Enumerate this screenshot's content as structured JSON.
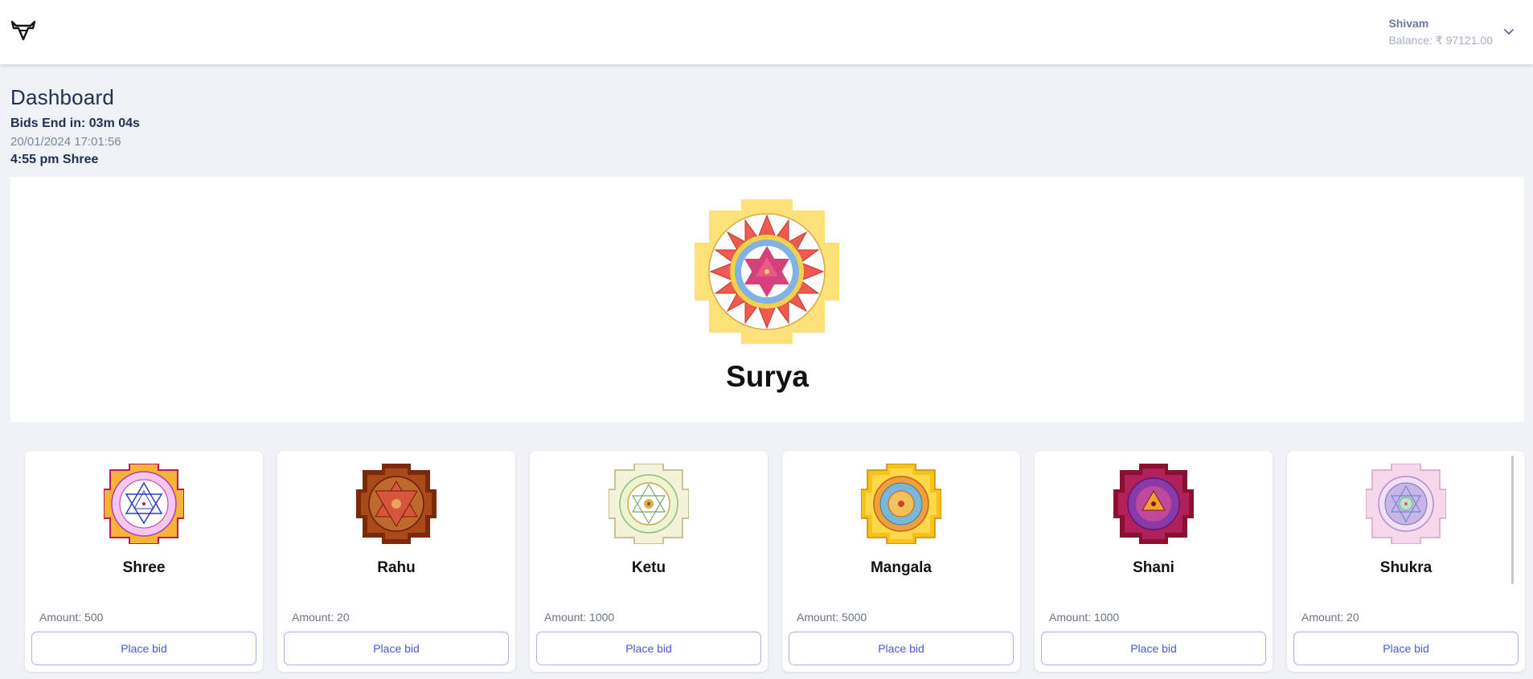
{
  "topbar": {
    "logo_icon": "bull-head-icon",
    "user_name": "Shivam",
    "balance": "Balance: ₹ 97121.00",
    "menu_icon": "chevron-down-icon"
  },
  "dashboard": {
    "title": "Dashboard",
    "bids_end": "Bids End in: 03m 04s",
    "datetime": "20/01/2024 17:01:56",
    "slot": "4:55 pm Shree"
  },
  "hero": {
    "name": "Surya",
    "icon": "surya-yantra-icon"
  },
  "cards": [
    {
      "name": "Shree",
      "amount": "Amount: 500",
      "button": "Place bid",
      "icon": "shree-yantra-icon"
    },
    {
      "name": "Rahu",
      "amount": "Amount: 20",
      "button": "Place bid",
      "icon": "rahu-yantra-icon"
    },
    {
      "name": "Ketu",
      "amount": "Amount: 1000",
      "button": "Place bid",
      "icon": "ketu-yantra-icon"
    },
    {
      "name": "Mangala",
      "amount": "Amount: 5000",
      "button": "Place bid",
      "icon": "mangala-yantra-icon"
    },
    {
      "name": "Shani",
      "amount": "Amount: 1000",
      "button": "Place bid",
      "icon": "shani-yantra-icon"
    },
    {
      "name": "Shukra",
      "amount": "Amount: 20",
      "button": "Place bid",
      "icon": "shukra-yantra-icon"
    }
  ],
  "colors": {
    "accent": "#4a5ad8",
    "background": "#eff2f7"
  }
}
